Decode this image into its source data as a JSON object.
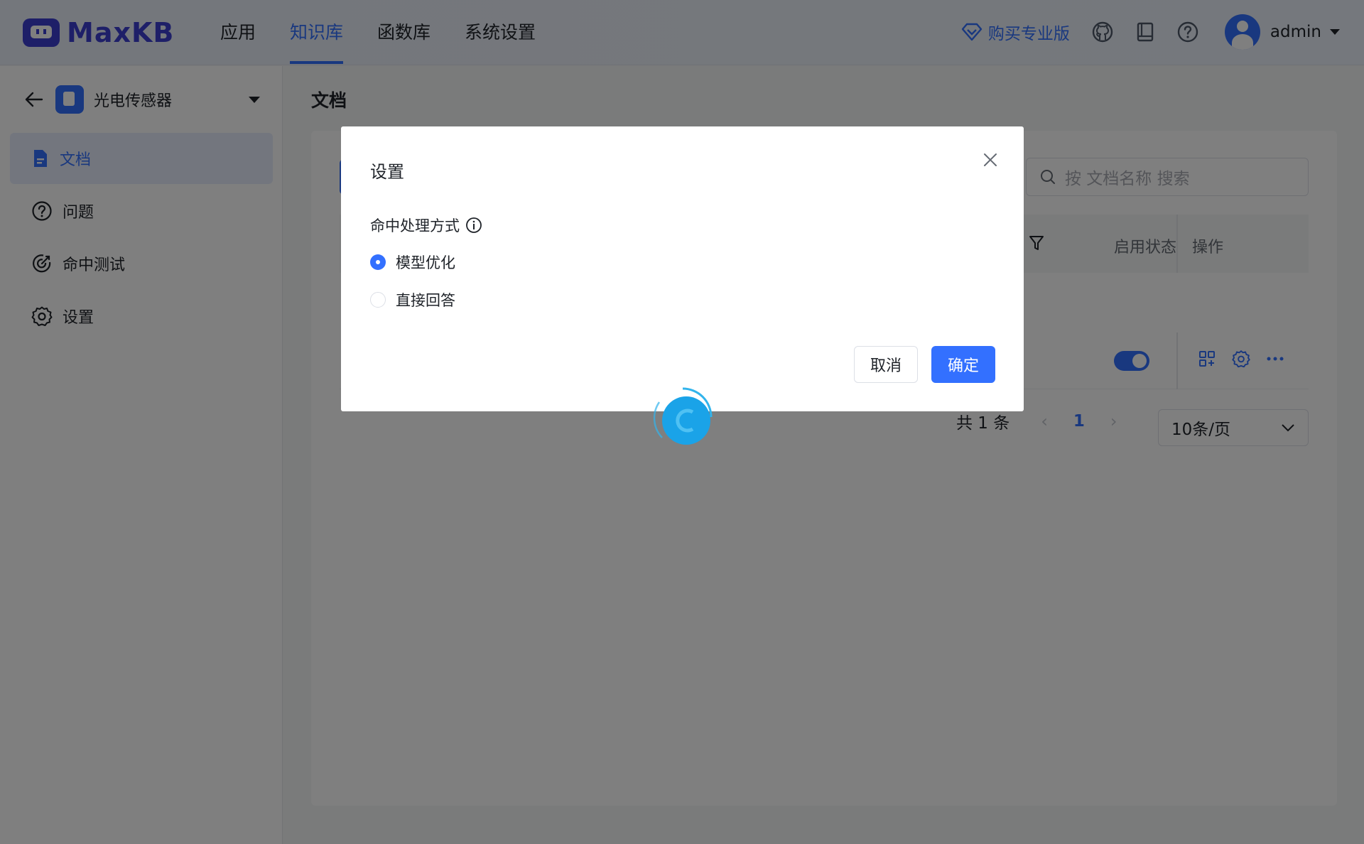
{
  "header": {
    "logo_text": "MaxKB",
    "nav": [
      {
        "label": "应用",
        "active": false
      },
      {
        "label": "知识库",
        "active": true
      },
      {
        "label": "函数库",
        "active": false
      },
      {
        "label": "系统设置",
        "active": false
      }
    ],
    "buy_label": "购买专业版",
    "username": "admin"
  },
  "sidebar": {
    "knowledge_base_name": "光电传感器",
    "items": [
      {
        "label": "文档",
        "icon": "document-icon",
        "active": true
      },
      {
        "label": "问题",
        "icon": "question-circle-icon",
        "active": false
      },
      {
        "label": "命中测试",
        "icon": "target-icon",
        "active": false
      },
      {
        "label": "设置",
        "icon": "gear-icon",
        "active": false
      }
    ]
  },
  "main": {
    "title": "文档",
    "search": {
      "placeholder": "按 文档名称 搜索"
    },
    "table": {
      "columns": [
        "启用状态",
        "操作"
      ]
    },
    "pagination": {
      "total_label": "共 1 条",
      "current_page": "1",
      "page_size": "10条/页"
    }
  },
  "dialog": {
    "title": "设置",
    "field_label": "命中处理方式",
    "options": [
      {
        "label": "模型优化",
        "checked": true
      },
      {
        "label": "直接回答",
        "checked": false
      }
    ],
    "cancel_label": "取消",
    "confirm_label": "确定"
  },
  "colors": {
    "primary": "#3370ff",
    "brand": "#3d3fd0"
  }
}
